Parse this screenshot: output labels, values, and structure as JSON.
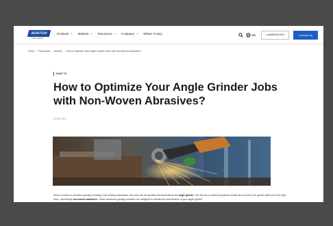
{
  "header": {
    "logo": {
      "text": "NORTON",
      "subtext": "SAINT-GOBAIN"
    },
    "nav": [
      {
        "label": "Products",
        "has_dropdown": true
      },
      {
        "label": "Markets",
        "has_dropdown": true
      },
      {
        "label": "Resources",
        "has_dropdown": true
      },
      {
        "label": "Company",
        "has_dropdown": true
      },
      {
        "label": "Where To Buy",
        "has_dropdown": false
      }
    ],
    "search_icon": "search-icon",
    "globe_icon": "globe-icon",
    "language": "EN",
    "my_button": "myABRASIVES",
    "contact_button": "Contact Us"
  },
  "breadcrumb": {
    "items": [
      "Home",
      "Resources",
      "Articles"
    ],
    "current": "How to Optimize Your Angle Grinder Jobs with Non-Woven Abrasives?"
  },
  "article": {
    "category": "HOW TO",
    "title": "How to Optimize Your Angle Grinder Jobs with Non-Woven Abrasives?",
    "date": "13 Apr 2023",
    "hero_image": "angle-grinder-sparks-photo",
    "body": {
      "p1_a": "When it comes to precision grinding, finishing, and surface preparation, few tools are as versatile and essential as the ",
      "p1_b": "angle grinder",
      "p1_c": ". Yet, the key to achieving optimal results lies not just in the grinder itself but in the right tools - specifically ",
      "p1_d": "non-woven abrasives",
      "p1_e": ". These advanced grinding solutions are designed to elevate the performance of your angle grinder."
    }
  },
  "colors": {
    "background": "#4a4a4a",
    "brand_blue": "#1c4ca3",
    "button_blue": "#1d5fc9"
  }
}
